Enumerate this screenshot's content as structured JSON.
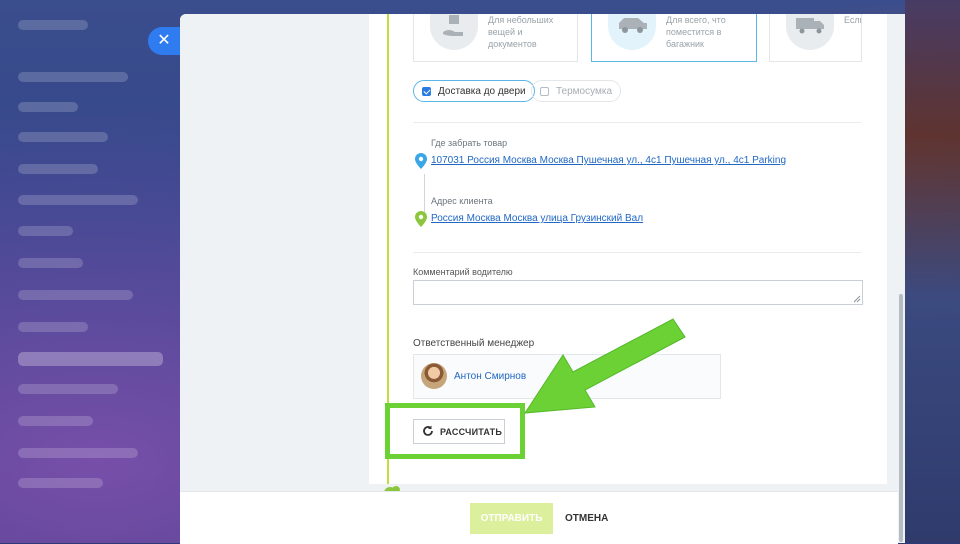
{
  "delivery_options": [
    {
      "text": "Для небольших вещей и документов",
      "icon": "hand-package-icon",
      "selected": false
    },
    {
      "text": "Для всего, что поместится в багажник",
      "icon": "car-icon",
      "selected": true
    },
    {
      "text": "Если маш",
      "icon": "truck-icon",
      "selected": false
    }
  ],
  "checks": {
    "door_delivery": "Доставка до двери",
    "thermo_bag": "Термосумка"
  },
  "pickup": {
    "label": "Где забрать товар",
    "address": "107031 Россия Москва Москва Пушечная ул., 4с1 Пушечная ул., 4с1 Parking"
  },
  "client": {
    "label": "Адрес клиента",
    "address": "Россия Москва Москва улица Грузинский Вал"
  },
  "driver_comment": {
    "label": "Комментарий водителю",
    "value": ""
  },
  "manager": {
    "label": "Ответственный менеджер",
    "name": "Антон Смирнов"
  },
  "calculate_label": "РАССЧИТАТЬ",
  "footer": {
    "send_label": "ОТПРАВИТЬ",
    "cancel_label": "ОТМЕНА"
  },
  "colors": {
    "accent_blue": "#2f7bf0",
    "link": "#2168c4",
    "timeline_green": "#c2dd3e",
    "highlight_green": "#6bd135",
    "send_disabled": "#dcef9c"
  }
}
